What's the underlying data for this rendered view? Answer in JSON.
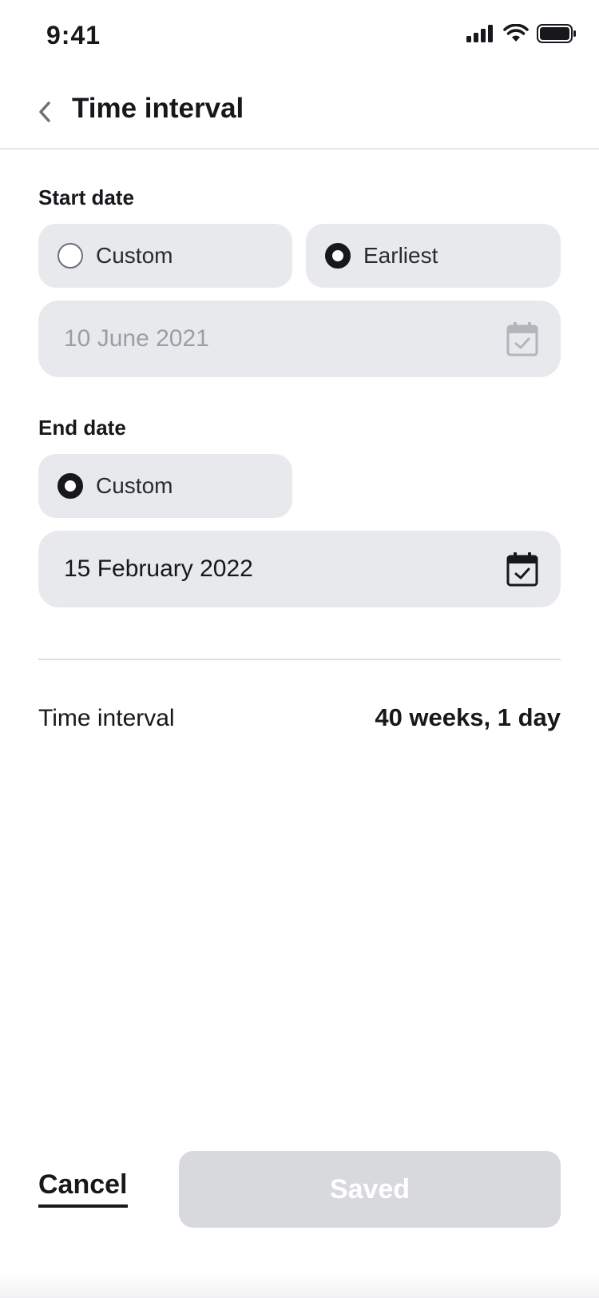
{
  "status_bar": {
    "time": "9:41"
  },
  "header": {
    "title": "Time interval"
  },
  "start_date": {
    "label": "Start date",
    "options": [
      "Custom",
      "Earliest"
    ],
    "selected": "Earliest",
    "date_value": "10 June 2021",
    "date_disabled": true
  },
  "end_date": {
    "label": "End date",
    "options": [
      "Custom"
    ],
    "selected": "Custom",
    "date_value": "15 February 2022"
  },
  "summary": {
    "label": "Time interval",
    "value": "40 weeks, 1 day"
  },
  "footer": {
    "cancel_label": "Cancel",
    "save_label": "Saved"
  },
  "colors": {
    "text": "#17181c",
    "field_bg": "#e8e9ed",
    "disabled_btn": "#d8d9dd",
    "disabled_text": "#9d9ea4"
  }
}
